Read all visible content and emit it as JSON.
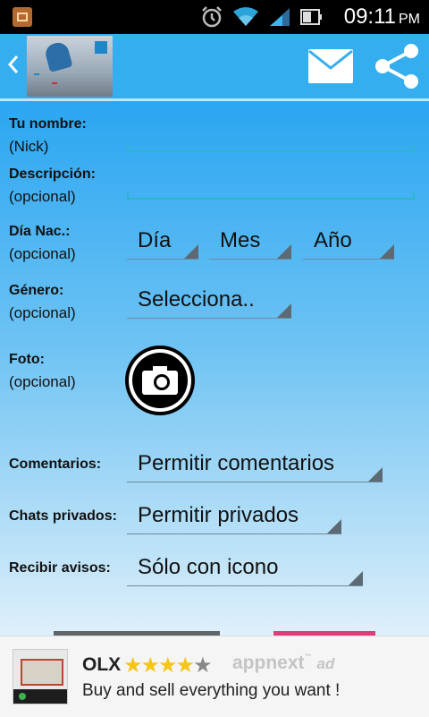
{
  "status_bar": {
    "time": "09:11",
    "ampm": "PM"
  },
  "form": {
    "name_label": "Tu nombre:",
    "name_hint": "(Nick)",
    "desc_label": "Descripción:",
    "desc_hint": "(opcional)",
    "birth_label": "Día Nac.:",
    "birth_hint": "(opcional)",
    "day_value": "Día",
    "month_value": "Mes",
    "year_value": "Año",
    "gender_label": "Género:",
    "gender_hint": "(opcional)",
    "gender_value": "Selecciona..",
    "photo_label": "Foto:",
    "photo_hint": "(opcional)",
    "comments_label": "Comentarios:",
    "comments_value": "Permitir comentarios",
    "chats_label": "Chats privados:",
    "chats_value": "Permitir privados",
    "notify_label": "Recibir avisos:",
    "notify_value": "Sólo con icono"
  },
  "ad": {
    "title": "OLX",
    "rating_stars": 4,
    "rating_max": 5,
    "brand": "appnext",
    "brand_tm": "™",
    "ad_label": "ad",
    "description": "Buy and sell everything you want !"
  },
  "colors": {
    "appbar": "#35aef0",
    "accent_line": "#2bb6c9",
    "ad_star": "#f5c518"
  },
  "icons": {
    "back": "chevron-left-icon",
    "mail": "mail-icon",
    "share": "share-icon",
    "camera": "camera-icon"
  }
}
